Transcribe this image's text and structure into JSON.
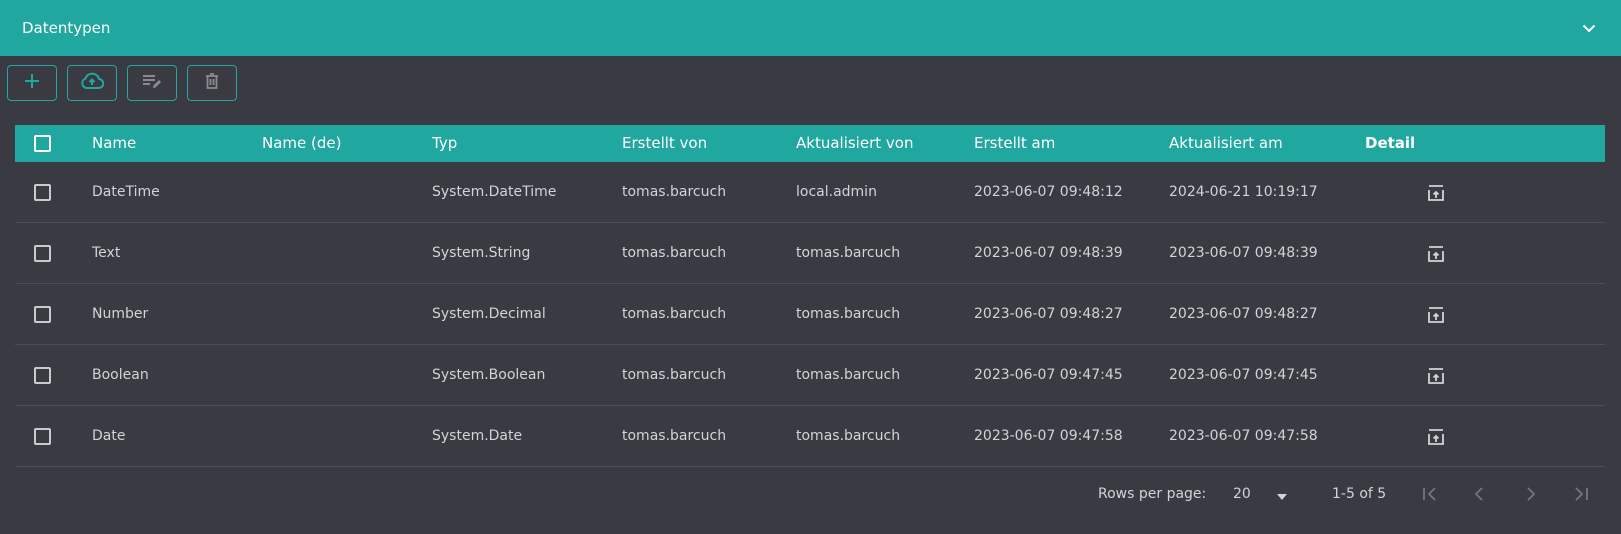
{
  "header": {
    "title": "Datentypen",
    "collapse_icon": "chevron-down-icon"
  },
  "toolbar": {
    "buttons": [
      {
        "name": "add",
        "icon": "plus-icon"
      },
      {
        "name": "upload",
        "icon": "cloud-upload-icon"
      },
      {
        "name": "edit",
        "icon": "edit-list-icon"
      },
      {
        "name": "delete",
        "icon": "trash-icon"
      }
    ]
  },
  "table": {
    "columns": [
      "Name",
      "Name (de)",
      "Typ",
      "Erstellt von",
      "Aktualisiert von",
      "Erstellt am",
      "Aktualisiert am",
      "Detail"
    ],
    "rows": [
      {
        "name": "DateTime",
        "name_de": "",
        "typ": "System.DateTime",
        "erstellt_von": "tomas.barcuch",
        "aktualisiert_von": "local.admin",
        "erstellt_am": "2023-06-07 09:48:12",
        "aktualisiert_am": "2024-06-21 10:19:17"
      },
      {
        "name": "Text",
        "name_de": "",
        "typ": "System.String",
        "erstellt_von": "tomas.barcuch",
        "aktualisiert_von": "tomas.barcuch",
        "erstellt_am": "2023-06-07 09:48:39",
        "aktualisiert_am": "2023-06-07 09:48:39"
      },
      {
        "name": "Number",
        "name_de": "",
        "typ": "System.Decimal",
        "erstellt_von": "tomas.barcuch",
        "aktualisiert_von": "tomas.barcuch",
        "erstellt_am": "2023-06-07 09:48:27",
        "aktualisiert_am": "2023-06-07 09:48:27"
      },
      {
        "name": "Boolean",
        "name_de": "",
        "typ": "System.Boolean",
        "erstellt_von": "tomas.barcuch",
        "aktualisiert_von": "tomas.barcuch",
        "erstellt_am": "2023-06-07 09:47:45",
        "aktualisiert_am": "2023-06-07 09:47:45"
      },
      {
        "name": "Date",
        "name_de": "",
        "typ": "System.Date",
        "erstellt_von": "tomas.barcuch",
        "aktualisiert_von": "tomas.barcuch",
        "erstellt_am": "2023-06-07 09:47:58",
        "aktualisiert_am": "2023-06-07 09:47:58"
      }
    ]
  },
  "pagination": {
    "rows_per_page_label": "Rows per page:",
    "rows_per_page_value": "20",
    "range_text": "1-5 of 5"
  },
  "colors": {
    "accent": "#20a79f",
    "background": "#3a3b42",
    "divider": "#4d4e55"
  }
}
